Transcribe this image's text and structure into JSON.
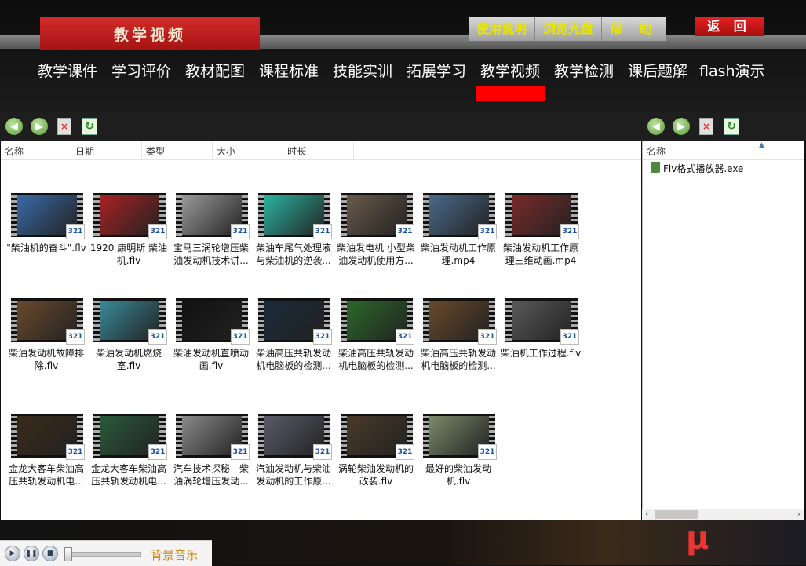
{
  "header": {
    "title": "教学视频",
    "buttons": [
      "使用说明",
      "浏览光盘",
      "帮 助"
    ],
    "back_label": "返 回"
  },
  "nav": {
    "items": [
      "教学课件",
      "学习评价",
      "教材配图",
      "课程标准",
      "技能实训",
      "拓展学习",
      "教学视频",
      "教学检测",
      "课后题解",
      "flash演示"
    ],
    "active": "教学视频"
  },
  "toolbar": {
    "icons": [
      "back-icon",
      "forward-icon",
      "delete-icon",
      "refresh-icon"
    ]
  },
  "left_pane": {
    "columns": [
      "名称",
      "日期",
      "类型",
      "大小",
      "时长"
    ],
    "files": [
      {
        "name": "\"柴油机的奋斗\".flv",
        "thumb": "#3b6aa8"
      },
      {
        "name": "1920 康明斯 柴油机.flv",
        "thumb": "#a82222"
      },
      {
        "name": "宝马三涡轮增压柴油发动机技术讲...",
        "thumb": "#9a9a9a"
      },
      {
        "name": "柴油车尾气处理液与柴油机的逆袭...",
        "thumb": "#2bb3a0"
      },
      {
        "name": "柴油发电机 小型柴油发动机使用方...",
        "thumb": "#6a5a4a"
      },
      {
        "name": "柴油发动机工作原理.mp4",
        "thumb": "#4a6a8a"
      },
      {
        "name": "柴油发动机工作原理三维动画.mp4",
        "thumb": "#7a2a2a"
      },
      {
        "name": "柴油发动机故障排除.flv",
        "thumb": "#6a4a2a"
      },
      {
        "name": "柴油发动机燃烧室.flv",
        "thumb": "#3a8a9a"
      },
      {
        "name": "柴油发动机直喷动画.flv",
        "thumb": "#111111"
      },
      {
        "name": "柴油高压共轨发动机电脑板的检测...",
        "thumb": "#1a2a3a"
      },
      {
        "name": "柴油高压共轨发动机电脑板的检测...",
        "thumb": "#2a6a2a"
      },
      {
        "name": "柴油高压共轨发动机电脑板的检测...",
        "thumb": "#6a4a2a"
      },
      {
        "name": "柴油机工作过程.flv",
        "thumb": "#5a5a5a"
      },
      {
        "name": "金龙大客车柴油高压共轨发动机电...",
        "thumb": "#3a2a1a"
      },
      {
        "name": "金龙大客车柴油高压共轨发动机电...",
        "thumb": "#2a5a3a"
      },
      {
        "name": "汽车技术探秘—柴油涡轮增压发动...",
        "thumb": "#8a8a8a"
      },
      {
        "name": "汽油发动机与柴油发动机的工作原...",
        "thumb": "#5a5a6a"
      },
      {
        "name": "涡轮柴油发动机的改装.flv",
        "thumb": "#4a3a2a"
      },
      {
        "name": "最好的柴油发动机.flv",
        "thumb": "#7a8a6a"
      }
    ],
    "badge": "321"
  },
  "right_pane": {
    "column": "名称",
    "file": "Flv格式播放器.exe"
  },
  "player": {
    "label": "背景音乐"
  }
}
